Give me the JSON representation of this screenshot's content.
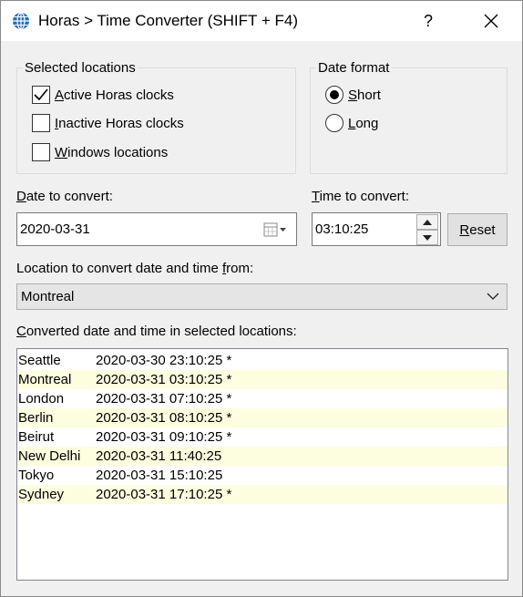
{
  "window": {
    "title": "Horas > Time Converter (SHIFT + F4)",
    "help_label": "?"
  },
  "selected_locations": {
    "title": "Selected locations",
    "items": [
      {
        "label_first": "A",
        "label_rest": "ctive Horas clocks",
        "checked": true
      },
      {
        "label_first": "I",
        "label_rest": "nactive Horas clocks",
        "checked": false
      },
      {
        "label_first": "W",
        "label_rest": "indows locations",
        "checked": false
      }
    ]
  },
  "date_format": {
    "title": "Date format",
    "options": [
      {
        "label_first": "S",
        "label_rest": "hort",
        "selected": true
      },
      {
        "label_first": "L",
        "label_rest": "ong",
        "selected": false
      }
    ]
  },
  "date_to_convert": {
    "label_first": "D",
    "label_rest": "ate to convert:",
    "value": "2020-03-31"
  },
  "time_to_convert": {
    "label_first": "T",
    "label_rest": "ime to convert:",
    "value": "03:10:25"
  },
  "reset_button": {
    "label_first": "R",
    "label_rest": "eset"
  },
  "location_from": {
    "label_start": "Location to convert date and time ",
    "label_u": "f",
    "label_end": "rom:",
    "selected": "Montreal"
  },
  "converted": {
    "label_first": "C",
    "label_rest": "onverted date and time in selected locations:",
    "rows": [
      {
        "location": "Seattle",
        "datetime": "2020-03-30 23:10:25 *"
      },
      {
        "location": "Montreal",
        "datetime": "2020-03-31 03:10:25 *"
      },
      {
        "location": "London",
        "datetime": "2020-03-31 07:10:25 *"
      },
      {
        "location": "Berlin",
        "datetime": "2020-03-31 08:10:25 *"
      },
      {
        "location": "Beirut",
        "datetime": "2020-03-31 09:10:25 *"
      },
      {
        "location": "New Delhi",
        "datetime": "2020-03-31 11:40:25"
      },
      {
        "location": "Tokyo",
        "datetime": "2020-03-31 15:10:25"
      },
      {
        "location": "Sydney",
        "datetime": "2020-03-31 17:10:25 *"
      }
    ]
  },
  "colors": {
    "row_highlight": "#fdfde0",
    "combo_background": "#e5e5e5",
    "globe_blue": "#2a6fb5"
  },
  "icons": {
    "app": "globe-icon",
    "close": "close-icon",
    "calendar": "calendar-dropdown-icon",
    "spin_up": "spin-up-icon",
    "spin_down": "spin-down-icon",
    "combo": "chevron-down-icon",
    "check": "checkmark-icon"
  }
}
